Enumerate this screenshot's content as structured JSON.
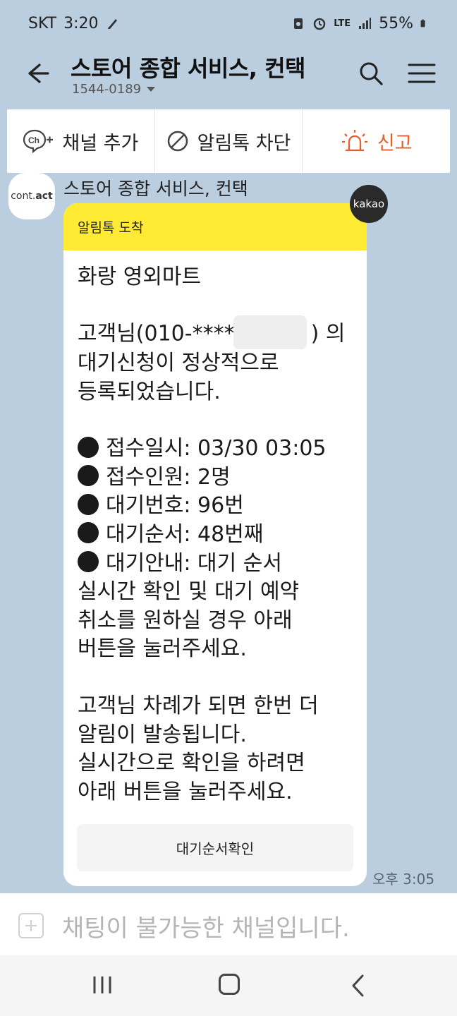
{
  "status_bar": {
    "carrier": "SKT",
    "time": "3:20",
    "network": "LTE",
    "battery": "55%"
  },
  "header": {
    "title": "스토어 종합 서비스, 컨택",
    "phone": "1544-0189"
  },
  "actions": {
    "add_channel": "채널 추가",
    "block": "알림톡 차단",
    "report": "신고"
  },
  "sender": {
    "avatar_text_light": "cont.",
    "avatar_text_bold": "act",
    "name": "스토어 종합 서비스, 컨택",
    "badge": "kakao"
  },
  "message": {
    "header": "알림톡 도착",
    "shop": "화랑 영외마트",
    "intro_prefix": "고객님(010-****",
    "intro_suffix": ") 의",
    "intro_line2": "대기신청이 정상적으로",
    "intro_line3": "등록되었습니다.",
    "bullets": [
      "접수일시: 03/30 03:05",
      "접수인원: 2명",
      "대기번호: 96번",
      "대기순서: 48번째",
      "대기안내: 대기 순서"
    ],
    "guide_line2": "실시간 확인 및 대기 예약",
    "guide_line3": "취소를 원하실 경우 아래",
    "guide_line4": "버튼을 눌러주세요.",
    "outro_line1": "고객님 차례가 되면 한번 더",
    "outro_line2": "알림이 발송됩니다.",
    "outro_line3": "실시간으로 확인을 하려면",
    "outro_line4": "아래 버튼을 눌러주세요.",
    "button": "대기순서확인",
    "time": "오후 3:05"
  },
  "input": {
    "placeholder": "채팅이 불가능한 채널입니다."
  },
  "colors": {
    "chat_bg": "#bacee0",
    "notice_yellow": "#ffeb33",
    "report_orange": "#e0612e"
  }
}
